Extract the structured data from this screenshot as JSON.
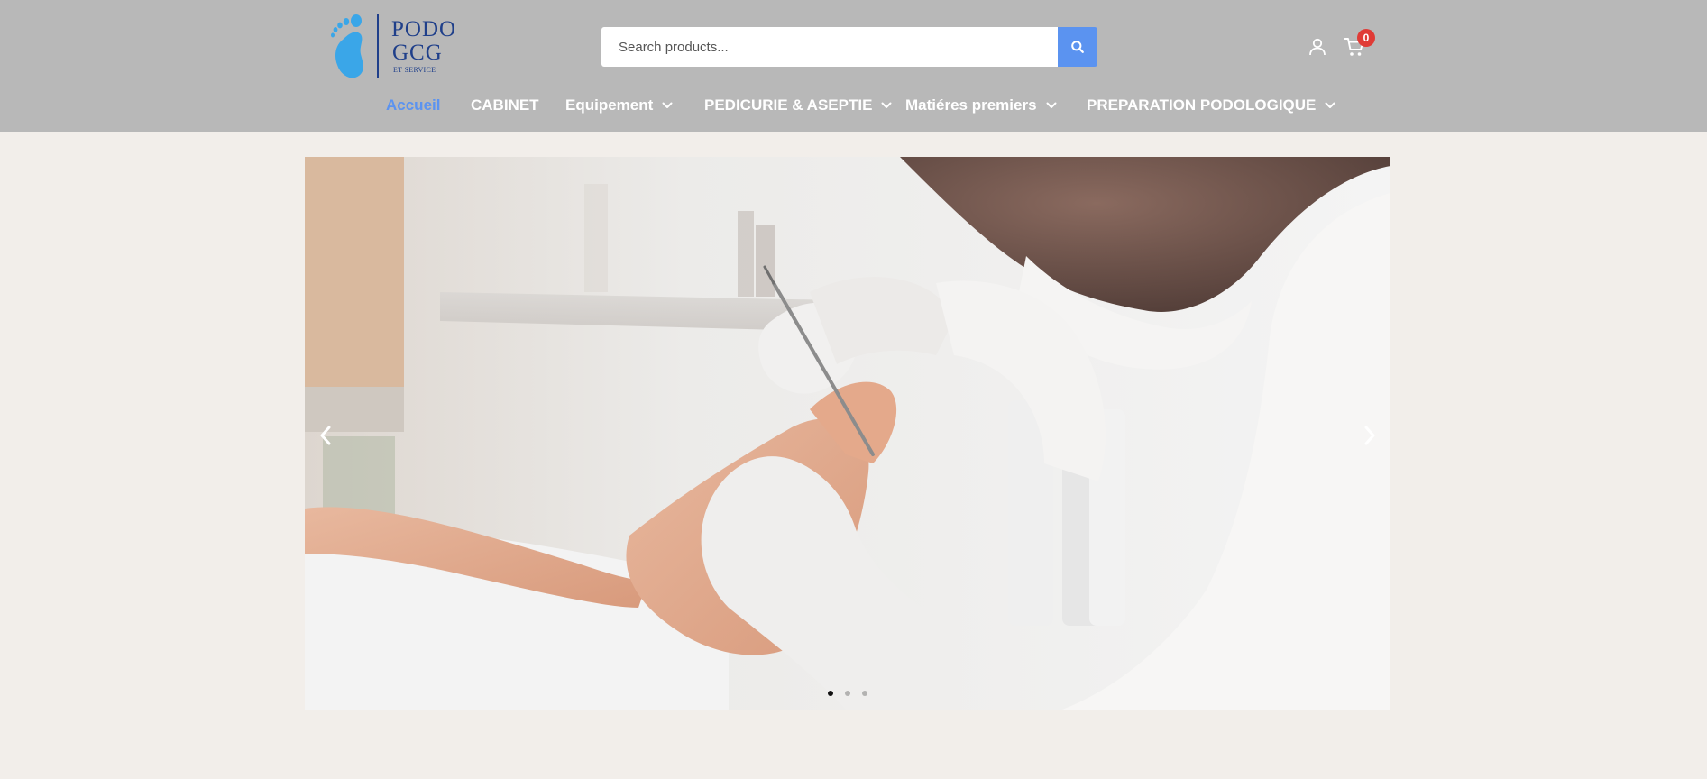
{
  "brand": {
    "line1": "PODO",
    "line2": "GCG",
    "line3": "ET SERVICE",
    "color": "#1f3f8a",
    "foot_color": "#3aa6e8"
  },
  "search": {
    "placeholder": "Search products...",
    "button_icon": "search-icon",
    "accent": "#5b93f0"
  },
  "header_icons": {
    "account": "user-icon",
    "cart": "cart-icon",
    "cart_count": "0",
    "badge_color": "#e03b36"
  },
  "nav": {
    "items": [
      {
        "label": "Accueil",
        "active": true,
        "dropdown": false
      },
      {
        "label": "CABINET",
        "active": false,
        "dropdown": false
      },
      {
        "label": "Equipement",
        "active": false,
        "dropdown": true
      },
      {
        "label": "PEDICURIE & ASEPTIE",
        "active": false,
        "dropdown": true
      },
      {
        "label": "Matiéres premiers",
        "active": false,
        "dropdown": true
      },
      {
        "label": "PREPARATION PODOLOGIQUE",
        "active": false,
        "dropdown": true
      }
    ],
    "active_color": "#5b93f0"
  },
  "slider": {
    "slide_count": 3,
    "active_slide": 1,
    "prev_icon": "chevron-left-icon",
    "next_icon": "chevron-right-icon",
    "image": "podiatrist-treating-foot-photo"
  },
  "colors": {
    "header_bg": "#b8b8b8",
    "page_bg": "#f2eeea"
  }
}
